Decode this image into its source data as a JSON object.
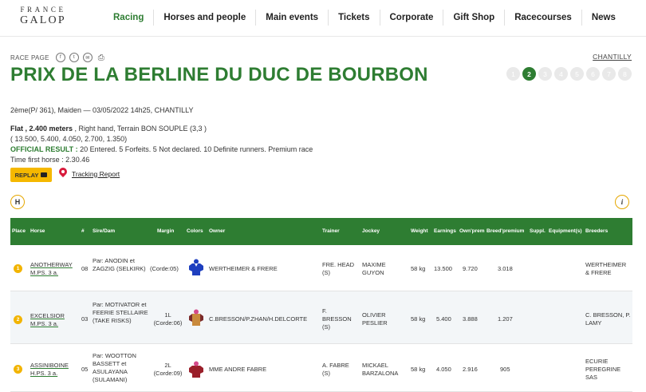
{
  "header": {
    "logo_top": "FRANCE",
    "logo_bottom": "GALOP",
    "nav": [
      {
        "label": "Racing",
        "active": true
      },
      {
        "label": "Horses and people",
        "active": false
      },
      {
        "label": "Main events",
        "active": false
      },
      {
        "label": "Tickets",
        "active": false
      },
      {
        "label": "Corporate",
        "active": false
      },
      {
        "label": "Gift Shop",
        "active": false
      },
      {
        "label": "Racecourses",
        "active": false
      },
      {
        "label": "News",
        "active": false
      }
    ]
  },
  "race": {
    "page_label": "RACE PAGE",
    "share_icons": [
      "facebook-icon",
      "twitter-icon",
      "email-icon",
      "print-icon"
    ],
    "venue": "CHANTILLY",
    "title": "PRIX DE LA BERLINE DU DUC DE BOURBON",
    "pager": [
      "1",
      "2",
      "3",
      "4",
      "5",
      "6",
      "7",
      "8"
    ],
    "pager_active": "2",
    "summary": "2ème(P/ 361), Maiden — 03/05/2022 14h25, CHANTILLY",
    "surface": "Flat , 2.400 meters",
    "surface_rest": " , Right hand, Terrain BON SOUPLE (3,3 )",
    "prizes": "( 13.500, 5.400, 4.050, 2.700, 1.350)",
    "official_label": "OFFICIAL RESULT :",
    "official_text": " 20 Entered. 5 Forfeits. 5 Not declared. 10 Definite runners. Premium race",
    "time_first": "Time first horse : 2.30.46",
    "replay_label": "REPLAY",
    "tracking_label": "Tracking Report"
  },
  "table": {
    "headers": {
      "place": "Place",
      "horse": "Horse",
      "number": "#",
      "sire": "Sire/Dam",
      "margin": "Margin",
      "colors": "Colors",
      "owner": "Owner",
      "trainer": "Trainer",
      "jockey": "Jockey",
      "weight": "Weight",
      "earnings": "Earnings",
      "ownprem": "Own'prem",
      "breedprem": "Breed'premium",
      "suppl": "Suppl.",
      "equipment": "Equipment(s)",
      "breeders": "Breeders"
    },
    "rows": [
      {
        "place": "1",
        "horse": "ANOTHERWAY",
        "horse_info": "M.PS. 3 a.",
        "number": "08",
        "sire": "Par: ANODIN et ZAGZIG (SELKIRK)",
        "margin": "(Corde:05)",
        "silk_body": "#1e3fbf",
        "silk_sleeve": "#1e3fbf",
        "silk_cap": "#1e3fbf",
        "owner": "WERTHEIMER & FRERE",
        "trainer": "FRE. HEAD (S)",
        "jockey": "MAXIME GUYON",
        "weight": "58 kg",
        "earnings": "13.500",
        "ownprem": "9.720",
        "breedprem": "3.018",
        "breeders": "WERTHEIMER & FRERE"
      },
      {
        "place": "2",
        "horse": "EXCELSIOR",
        "horse_info": "M.PS. 3 a.",
        "number": "03",
        "sire": "Par: MOTIVATOR et FEERIE STELLAIRE (TAKE RISKS)",
        "margin_top": "1L",
        "margin": "(Corde:06)",
        "silk_body": "#c98a3c",
        "silk_sleeve": "#7a2a2a",
        "silk_cap": "#d54a8a",
        "owner": "C.BRESSON/P.ZHAN/H.DELCORTE",
        "trainer": "F. BRESSON (S)",
        "jockey": "OLIVIER PESLIER",
        "weight": "58 kg",
        "earnings": "5.400",
        "ownprem": "3.888",
        "breedprem": "1.207",
        "breeders": "C. BRESSON, P. LAMY"
      },
      {
        "place": "3",
        "horse": "ASSINIBOINE",
        "horse_info": "H.PS. 3 a.",
        "number": "05",
        "sire": "Par: WOOTTON BASSETT et ASULAYANA (SULAMANI)",
        "margin_top": "2L",
        "margin": "(Corde:09)",
        "silk_body": "#9a1f2a",
        "silk_sleeve": "#9a1f2a",
        "silk_cap": "#d54a8a",
        "owner": "MME ANDRE FABRE",
        "trainer": "A. FABRE (S)",
        "jockey": "MICKAEL BARZALONA",
        "weight": "58 kg",
        "earnings": "4.050",
        "ownprem": "2.916",
        "breedprem": "905",
        "breeders": "ECURIE PEREGRINE SAS"
      }
    ]
  },
  "icons": {
    "left_control": "H",
    "right_control": "i"
  },
  "colors": {
    "brand_green": "#2e7d32",
    "accent_yellow": "#f5b800",
    "pin_red": "#d81b3c"
  }
}
